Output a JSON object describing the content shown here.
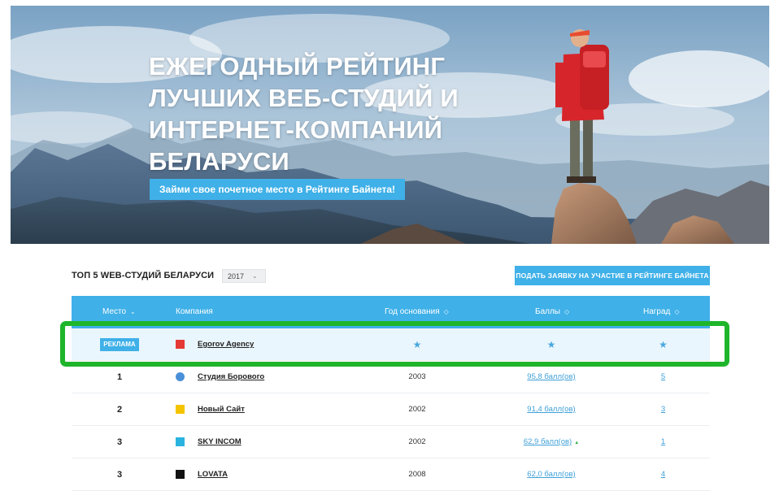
{
  "hero": {
    "title_lines": [
      "ЕЖЕГОДНЫЙ РЕЙТИНГ",
      "ЛУЧШИХ ВЕБ-СТУДИЙ И",
      "ИНТЕРНЕТ-КОМПАНИЙ",
      "БЕЛАРУСИ"
    ],
    "cta_label": "Займи свое почетное место в Рейтинге Байнета!"
  },
  "toolbar": {
    "title": "ТОП 5 WEB-СТУДИЙ БЕЛАРУСИ",
    "year_selected": "2017",
    "apply_label": "ПОДАТЬ ЗАЯВКУ НА УЧАСТИЕ В РЕЙТИНГЕ БАЙНЕТА"
  },
  "table": {
    "headers": {
      "place": "Место",
      "company": "Компания",
      "year": "Год основания",
      "score": "Баллы",
      "awards": "Наград"
    },
    "ad_row": {
      "badge": "РЕКЛАМА",
      "company": "Egorov Agency",
      "logo_color": "#e53935"
    },
    "rows": [
      {
        "place": "1",
        "company": "Студия Борового",
        "year": "2003",
        "score": "95,8 балл(ов)",
        "awards": "5",
        "logo_color": "#4a90d9"
      },
      {
        "place": "2",
        "company": "Новый Сайт",
        "year": "2002",
        "score": "91,4 балл(ов)",
        "awards": "3",
        "logo_color": "#f5c400"
      },
      {
        "place": "3",
        "company": "SKY INCOM",
        "year": "2002",
        "score": "62,9 балл(ов)",
        "awards": "1",
        "logo_color": "#2bb3e0",
        "trend": "▲"
      },
      {
        "place": "3",
        "company": "LOVATA",
        "year": "2008",
        "score": "62,0 балл(ов)",
        "awards": "4",
        "logo_color": "#111111"
      }
    ]
  }
}
